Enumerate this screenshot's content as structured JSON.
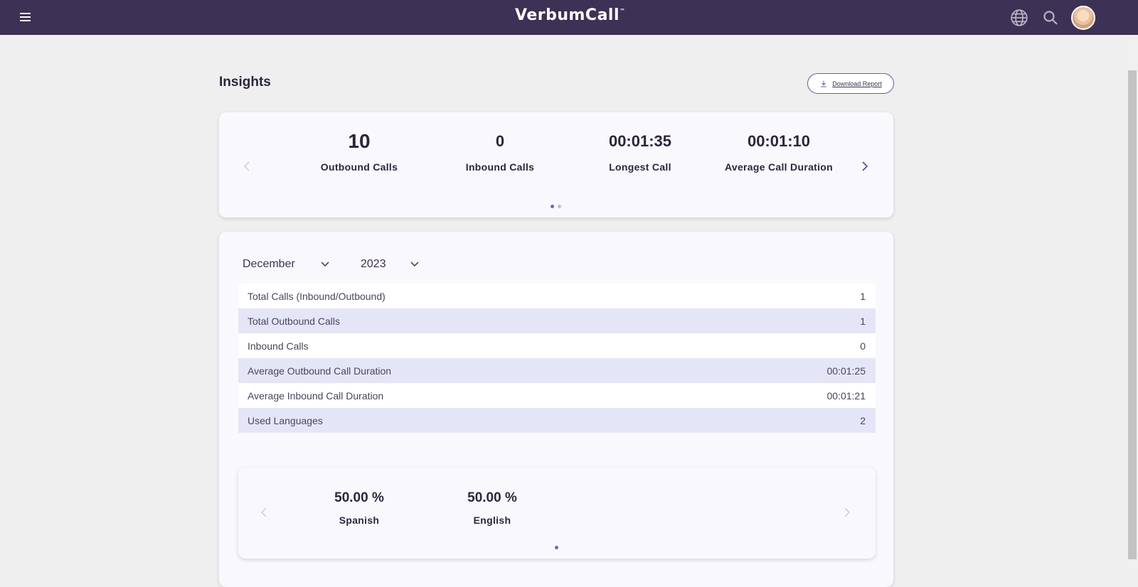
{
  "header": {
    "logo_text": "VerbumCall",
    "logo_tm": "™"
  },
  "page": {
    "title": "Insights",
    "download_label": "Download Report"
  },
  "stats": [
    {
      "value": "10",
      "label": "Outbound Calls"
    },
    {
      "value": "0",
      "label": "Inbound Calls"
    },
    {
      "value": "00:01:35",
      "label": "Longest Call"
    },
    {
      "value": "00:01:10",
      "label": "Average Call Duration"
    }
  ],
  "filters": {
    "month": "December",
    "year": "2023"
  },
  "table": [
    {
      "label": "Total Calls (Inbound/Outbound)",
      "value": "1"
    },
    {
      "label": "Total Outbound Calls",
      "value": "1"
    },
    {
      "label": "Inbound Calls",
      "value": "0"
    },
    {
      "label": "Average Outbound Call Duration",
      "value": "00:01:25"
    },
    {
      "label": "Average Inbound Call Duration",
      "value": "00:01:21"
    },
    {
      "label": "Used Languages",
      "value": "2"
    }
  ],
  "languages": [
    {
      "value": "50.00 %",
      "label": "Spanish"
    },
    {
      "value": "50.00 %",
      "label": "English"
    }
  ],
  "colors": {
    "topbar": "#3d3155",
    "accent": "#5c6bd8",
    "row_alt": "#e4e6f7"
  },
  "icons": {
    "menu": "menu-icon",
    "globe": "globe-icon",
    "search": "search-icon",
    "download": "download-icon",
    "prev": "chevron-left-icon",
    "next": "chevron-right-icon",
    "dropdown": "chevron-down-icon"
  }
}
